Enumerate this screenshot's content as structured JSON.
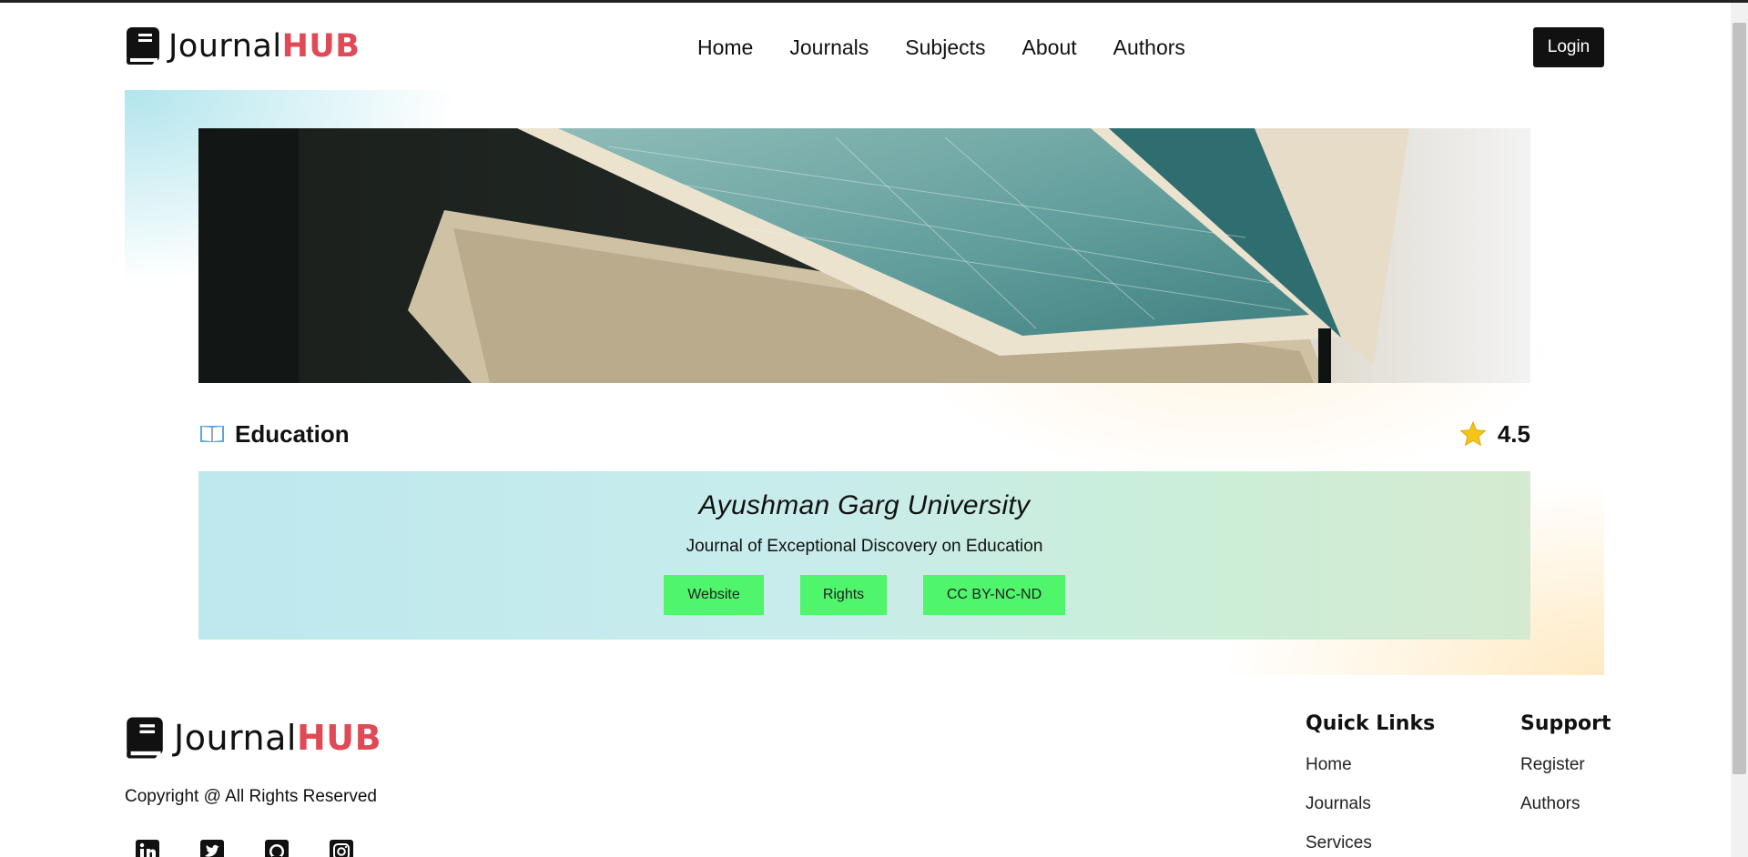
{
  "brand": {
    "name_part1": "Journal",
    "name_part2": "HUB"
  },
  "nav": {
    "items": [
      "Home",
      "Journals",
      "Subjects",
      "About",
      "Authors"
    ]
  },
  "header": {
    "login_label": "Login"
  },
  "journal": {
    "subject": "Education",
    "rating": "4.5",
    "university": "Ayushman Garg University",
    "title": "Journal of Exceptional Discovery on Education",
    "tags": {
      "website": "Website",
      "rights": "Rights",
      "license": "CC BY-NC-ND"
    }
  },
  "footer": {
    "brand_part1": "Journal",
    "brand_part2": "HUB",
    "copyright": "Copyright @ All Rights Reserved",
    "socials": [
      "linkedin-icon",
      "twitter-icon",
      "github-icon",
      "instagram-icon"
    ],
    "quick_links": {
      "heading": "Quick Links",
      "items": [
        "Home",
        "Journals",
        "Services"
      ]
    },
    "support": {
      "heading": "Support",
      "items": [
        "Register",
        "Authors"
      ]
    }
  },
  "colors": {
    "accent": "#e04a57",
    "tag_green": "#4ff56a",
    "button_dark": "#111111",
    "star": "#f5c518"
  }
}
